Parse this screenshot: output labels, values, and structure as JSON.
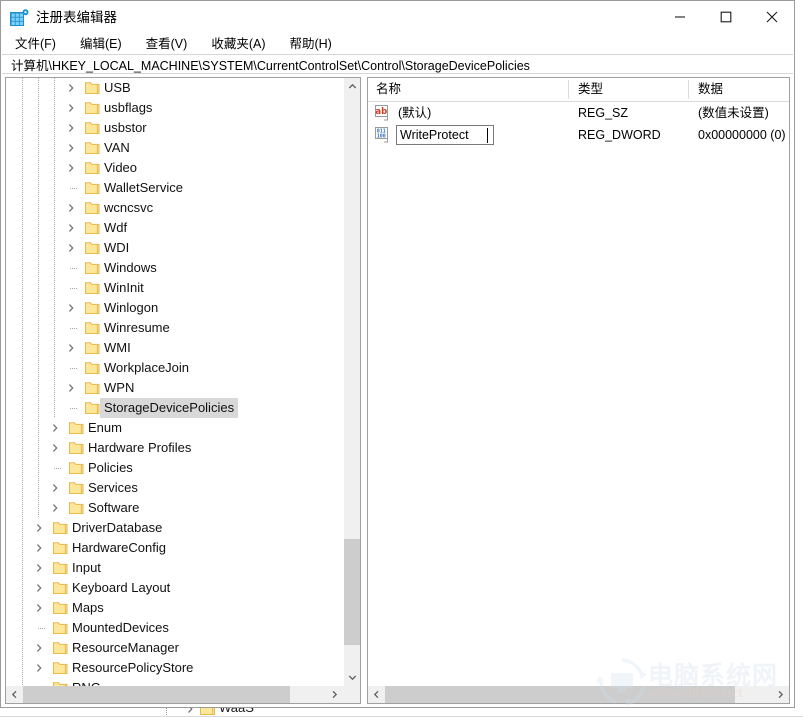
{
  "window": {
    "title": "注册表编辑器",
    "app_icon": "registry-editor-icon",
    "controls": {
      "minimize": "minimize-icon",
      "maximize": "maximize-icon",
      "close": "close-icon"
    }
  },
  "menubar": {
    "items": [
      {
        "label": "文件(F)",
        "name": "menu-file"
      },
      {
        "label": "编辑(E)",
        "name": "menu-edit"
      },
      {
        "label": "查看(V)",
        "name": "menu-view"
      },
      {
        "label": "收藏夹(A)",
        "name": "menu-favorites"
      },
      {
        "label": "帮助(H)",
        "name": "menu-help"
      }
    ]
  },
  "address": {
    "path": "计算机\\HKEY_LOCAL_MACHINE\\SYSTEM\\CurrentControlSet\\Control\\StorageDevicePolicies"
  },
  "tree": {
    "items": [
      {
        "label": "USB",
        "depth": 3,
        "expandable": true,
        "selected": false
      },
      {
        "label": "usbflags",
        "depth": 3,
        "expandable": true,
        "selected": false
      },
      {
        "label": "usbstor",
        "depth": 3,
        "expandable": true,
        "selected": false
      },
      {
        "label": "VAN",
        "depth": 3,
        "expandable": true,
        "selected": false
      },
      {
        "label": "Video",
        "depth": 3,
        "expandable": true,
        "selected": false
      },
      {
        "label": "WalletService",
        "depth": 3,
        "expandable": false,
        "selected": false
      },
      {
        "label": "wcncsvc",
        "depth": 3,
        "expandable": true,
        "selected": false
      },
      {
        "label": "Wdf",
        "depth": 3,
        "expandable": true,
        "selected": false
      },
      {
        "label": "WDI",
        "depth": 3,
        "expandable": true,
        "selected": false
      },
      {
        "label": "Windows",
        "depth": 3,
        "expandable": false,
        "selected": false
      },
      {
        "label": "WinInit",
        "depth": 3,
        "expandable": false,
        "selected": false
      },
      {
        "label": "Winlogon",
        "depth": 3,
        "expandable": true,
        "selected": false
      },
      {
        "label": "Winresume",
        "depth": 3,
        "expandable": false,
        "selected": false
      },
      {
        "label": "WMI",
        "depth": 3,
        "expandable": true,
        "selected": false
      },
      {
        "label": "WorkplaceJoin",
        "depth": 3,
        "expandable": false,
        "selected": false
      },
      {
        "label": "WPN",
        "depth": 3,
        "expandable": true,
        "selected": false
      },
      {
        "label": "StorageDevicePolicies",
        "depth": 3,
        "expandable": false,
        "selected": true
      },
      {
        "label": "Enum",
        "depth": 2,
        "expandable": true,
        "selected": false
      },
      {
        "label": "Hardware Profiles",
        "depth": 2,
        "expandable": true,
        "selected": false
      },
      {
        "label": "Policies",
        "depth": 2,
        "expandable": false,
        "selected": false
      },
      {
        "label": "Services",
        "depth": 2,
        "expandable": true,
        "selected": false
      },
      {
        "label": "Software",
        "depth": 2,
        "expandable": true,
        "selected": false
      },
      {
        "label": "DriverDatabase",
        "depth": 1,
        "expandable": true,
        "selected": false
      },
      {
        "label": "HardwareConfig",
        "depth": 1,
        "expandable": true,
        "selected": false
      },
      {
        "label": "Input",
        "depth": 1,
        "expandable": true,
        "selected": false
      },
      {
        "label": "Keyboard Layout",
        "depth": 1,
        "expandable": true,
        "selected": false
      },
      {
        "label": "Maps",
        "depth": 1,
        "expandable": true,
        "selected": false
      },
      {
        "label": "MountedDevices",
        "depth": 1,
        "expandable": false,
        "selected": false
      },
      {
        "label": "ResourceManager",
        "depth": 1,
        "expandable": true,
        "selected": false
      },
      {
        "label": "ResourcePolicyStore",
        "depth": 1,
        "expandable": true,
        "selected": false
      },
      {
        "label": "RNG",
        "depth": 1,
        "expandable": false,
        "selected": false
      }
    ],
    "background_item": {
      "label": "WaaS",
      "expandable": true
    }
  },
  "list": {
    "columns": [
      {
        "label": "名称",
        "name": "column-name"
      },
      {
        "label": "类型",
        "name": "column-type"
      },
      {
        "label": "数据",
        "name": "column-data"
      }
    ],
    "rows": [
      {
        "icon": "string-value-icon",
        "name": "(默认)",
        "type": "REG_SZ",
        "data": "(数值未设置)",
        "editing": false
      },
      {
        "icon": "dword-value-icon",
        "name": "WriteProtect",
        "type": "REG_DWORD",
        "data": "0x00000000 (0)",
        "editing": true
      }
    ]
  },
  "scrollbars": {
    "tree_up_arrow": "chevron-up-icon",
    "tree_down_arrow": "chevron-down-icon",
    "tree_left_arrow": "chevron-left-icon",
    "tree_right_arrow": "chevron-right-icon",
    "list_left_arrow": "chevron-left-icon",
    "list_right_arrow": "chevron-right-icon"
  },
  "watermark": {
    "text": "电脑系统网",
    "url": "www.dnxtc.net"
  },
  "colors": {
    "folder": "#fde79a",
    "folder_border": "#e8b84b",
    "selection": "#d8d8d8",
    "scrollbar_thumb": "#cdcdcd",
    "scrollbar_track": "#f0f0f0",
    "string_icon_text": "#d03a26",
    "dword_icon_text": "#2a6fbf"
  }
}
